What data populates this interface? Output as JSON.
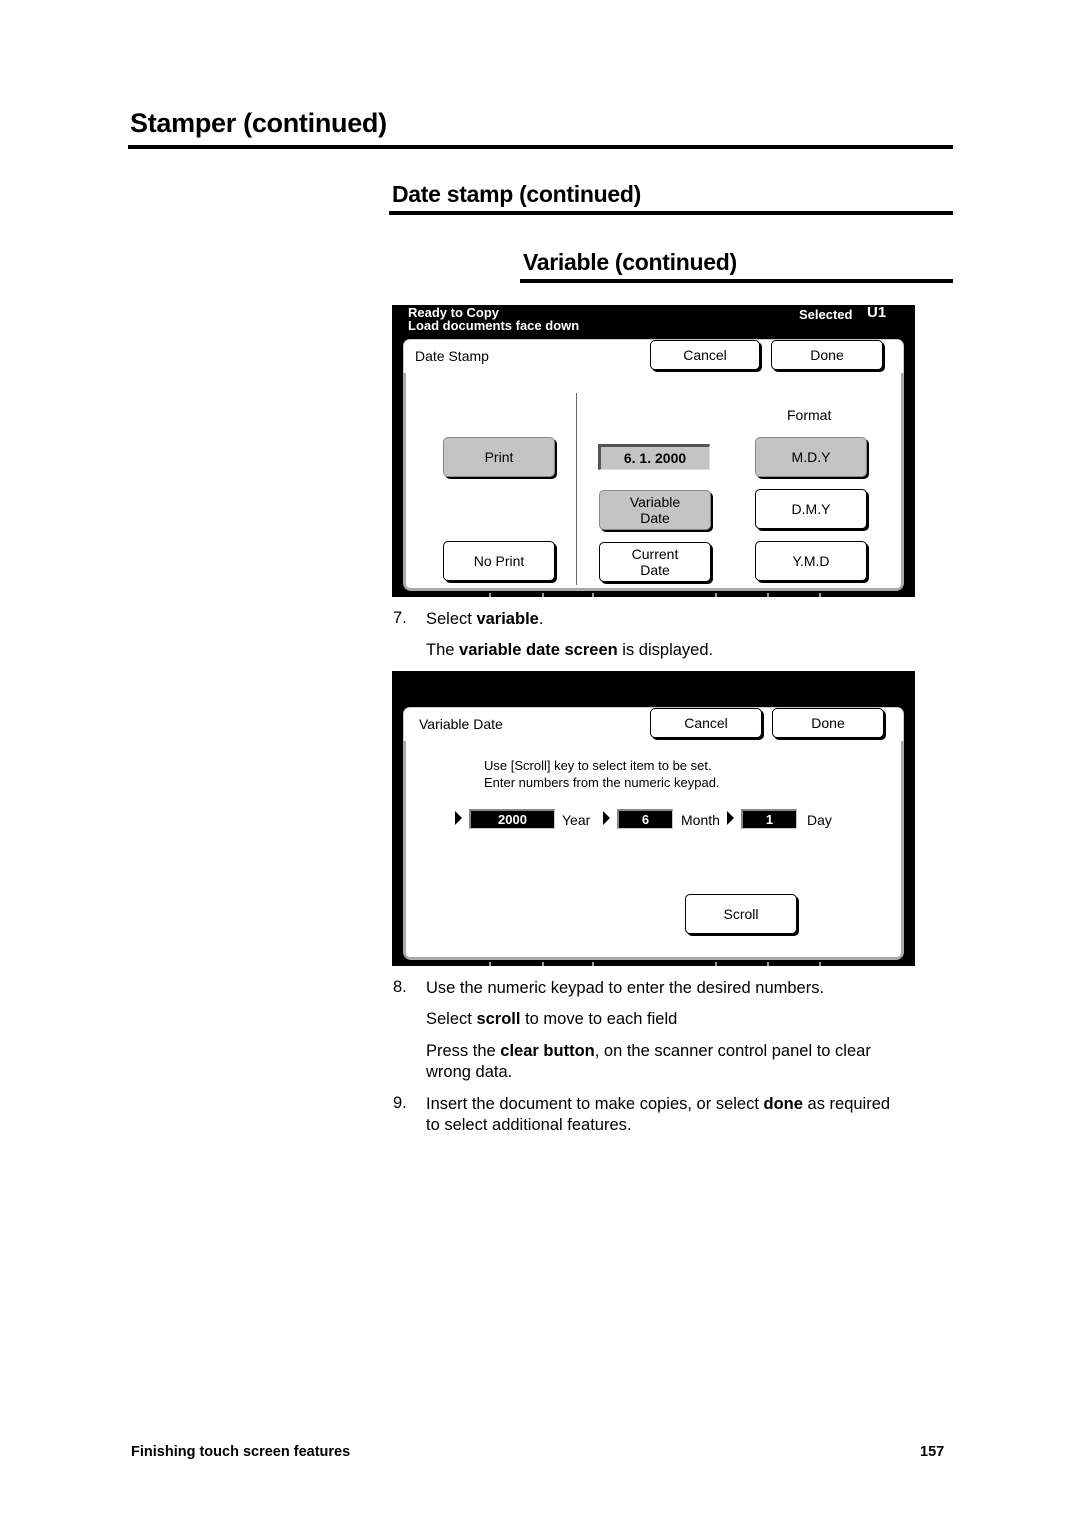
{
  "headings": {
    "h1": "Stamper (continued)",
    "h2": "Date stamp (continued)",
    "h3": "Variable (continued)"
  },
  "screen1": {
    "status_line1": "Ready to Copy",
    "status_line2": "Load documents face down",
    "selected_label": "Selected",
    "selected_value": "U1",
    "tab_label": "Date Stamp",
    "cancel": "Cancel",
    "done": "Done",
    "print": "Print",
    "no_print": "No Print",
    "date_value": "6. 1.  2000",
    "variable_date": [
      "Variable",
      "Date"
    ],
    "current_date": [
      "Current",
      "Date"
    ],
    "format_label": "Format",
    "formats": [
      "M.D.Y",
      "D.M.Y",
      "Y.M.D"
    ],
    "selected_format": "M.D.Y",
    "selected_print": "Print",
    "selected_date_mode": "Variable Date"
  },
  "step7": {
    "number": "7.",
    "text_pre": "Select ",
    "text_bold": "variable",
    "text_post": ".",
    "sub_pre": "The ",
    "sub_bold": "variable date screen",
    "sub_post": " is displayed."
  },
  "screen2": {
    "tab_label": "Variable Date",
    "cancel": "Cancel",
    "done": "Done",
    "instruction1": "Use [Scroll] key to select item to be set.",
    "instruction2": "Enter numbers from the numeric keypad.",
    "fields": [
      {
        "value": "2000",
        "label": "Year"
      },
      {
        "value": "6",
        "label": "Month"
      },
      {
        "value": "1",
        "label": "Day"
      }
    ],
    "scroll": "Scroll"
  },
  "step8": {
    "number": "8.",
    "line1": "Use the numeric keypad to enter the desired numbers.",
    "line2_pre": "Select ",
    "line2_bold": "scroll",
    "line2_post": " to move to each field",
    "line3_pre": "Press the ",
    "line3_bold": "clear button",
    "line3_post": ", on the scanner control panel to clear",
    "line3_cont": "wrong data."
  },
  "step9": {
    "number": "9.",
    "pre": "Insert the document to make copies, or select ",
    "bold": "done",
    "post": " as required",
    "cont": "to select additional features."
  },
  "footer": {
    "section": "Finishing touch screen features",
    "page": "157"
  }
}
